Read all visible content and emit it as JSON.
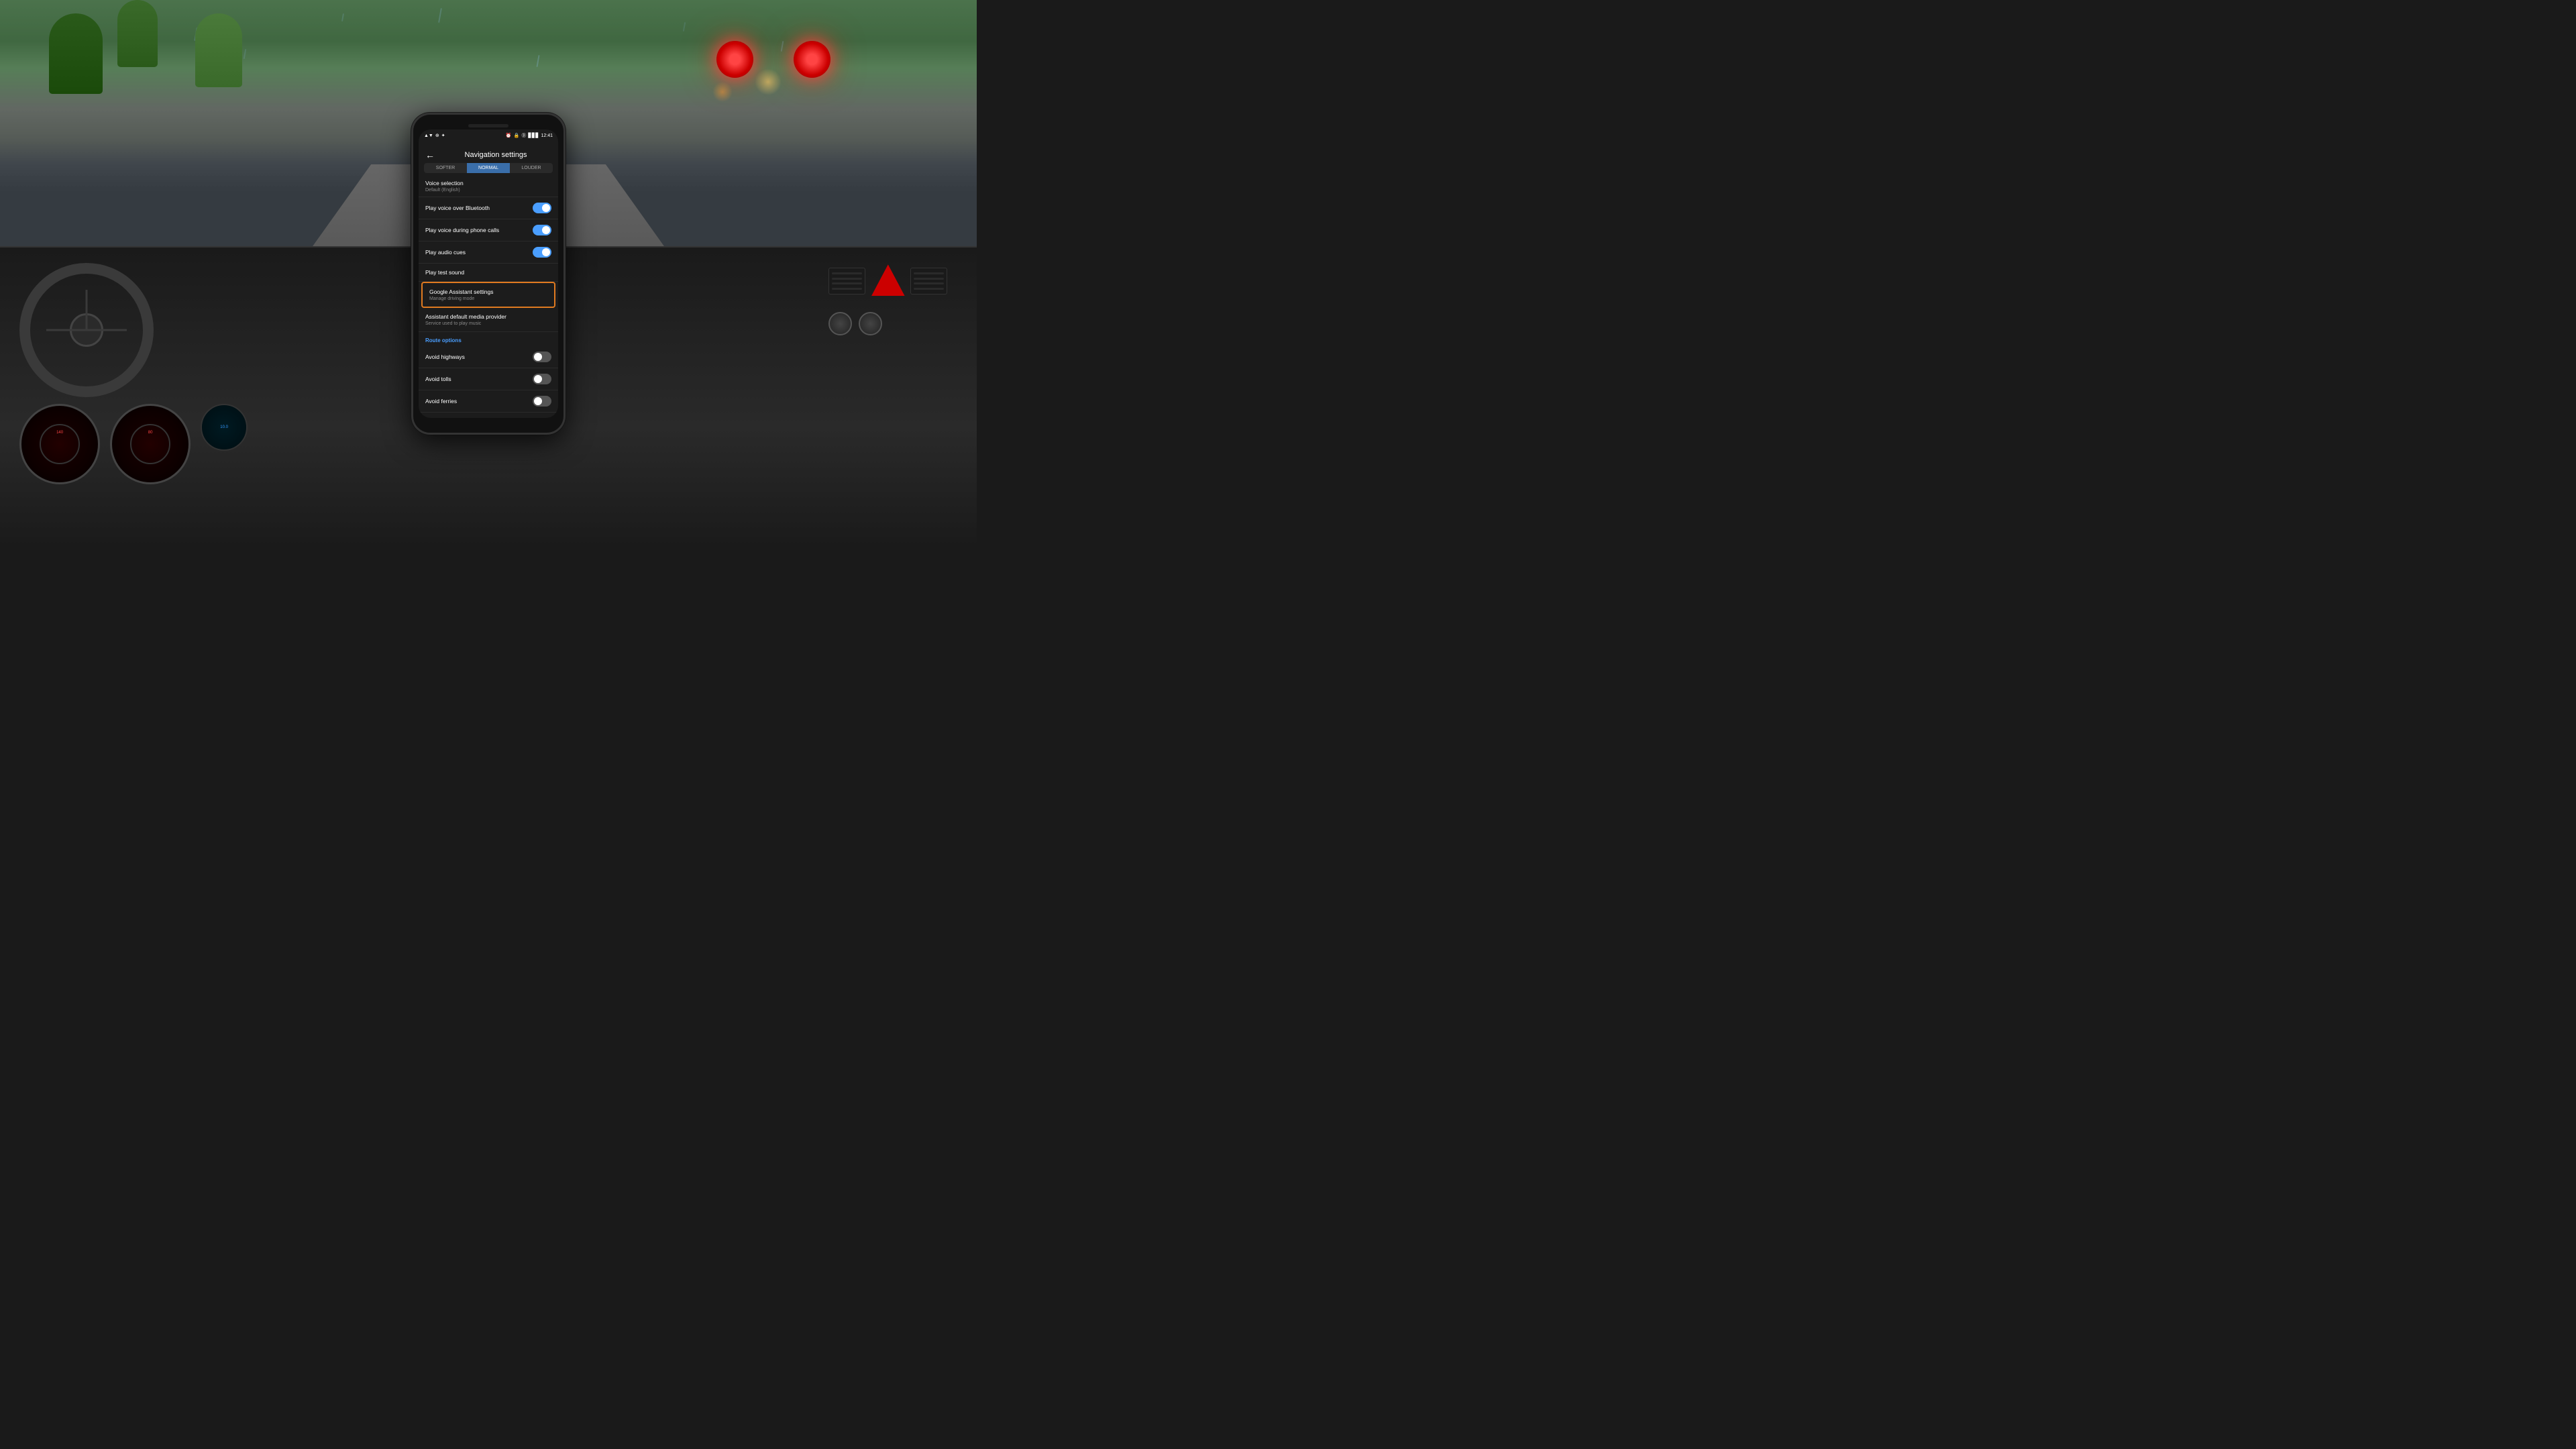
{
  "background": {
    "description": "Car interior with rainy windshield view, steering wheel on left, AC vents on right"
  },
  "phone": {
    "status_bar": {
      "signal": "▲▼",
      "wifi": "WiFi",
      "time": "12:41",
      "battery": "■■■",
      "icons": "🔔 ⚙"
    },
    "app": {
      "title": "Navigation settings",
      "back_label": "←",
      "volume_tabs": [
        {
          "label": "SOFTER",
          "active": false
        },
        {
          "label": "NORMAL",
          "active": true
        },
        {
          "label": "LOUDER",
          "active": false
        }
      ],
      "voice_selection": {
        "label": "Voice selection",
        "value": "Default (English)"
      },
      "settings": [
        {
          "id": "play-voice-bluetooth",
          "label": "Play voice over Bluetooth",
          "toggle": "on",
          "highlighted": false
        },
        {
          "id": "play-voice-phone-calls",
          "label": "Play voice during phone calls",
          "toggle": "on",
          "highlighted": false
        },
        {
          "id": "play-audio-cues",
          "label": "Play audio cues",
          "toggle": "on",
          "highlighted": false
        },
        {
          "id": "play-test-sound",
          "label": "Play test sound",
          "toggle": null,
          "highlighted": false
        },
        {
          "id": "google-assistant-settings",
          "label": "Google Assistant settings",
          "sublabel": "Manage driving mode",
          "toggle": null,
          "highlighted": true
        },
        {
          "id": "assistant-default-media",
          "label": "Assistant default media provider",
          "sublabel": "Service used to play music",
          "toggle": null,
          "highlighted": false
        }
      ],
      "route_options": {
        "header": "Route options",
        "items": [
          {
            "id": "avoid-highways",
            "label": "Avoid highways",
            "toggle": "off"
          },
          {
            "id": "avoid-tolls",
            "label": "Avoid tolls",
            "toggle": "off"
          },
          {
            "id": "avoid-ferries",
            "label": "Avoid ferries",
            "toggle": "off"
          }
        ]
      }
    }
  },
  "colors": {
    "toggle_on": "#4a9eff",
    "toggle_off": "#555555",
    "highlight_border": "#e07a20",
    "accent_blue": "#4a9eff",
    "screen_bg": "#1c1c1c",
    "header_text": "#ffffff",
    "subtext": "#888888"
  }
}
